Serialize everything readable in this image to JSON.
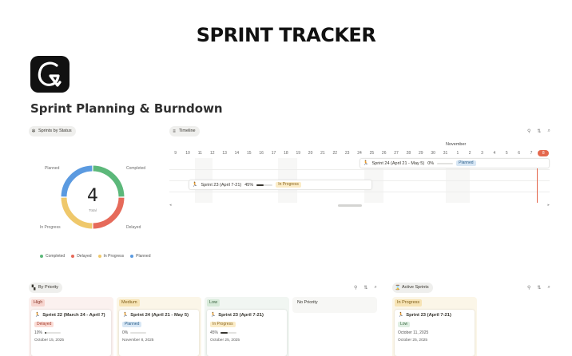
{
  "brand": "SPRINT TRACKER",
  "page_title": "Sprint Planning & Burndown",
  "status_chart": {
    "chip": "Sprints by Status",
    "total": "4",
    "total_label": "Total",
    "labels": {
      "planned": "Planned",
      "completed": "Completed",
      "in_progress": "In Progress",
      "delayed": "Delayed"
    },
    "legend": [
      "Completed",
      "Delayed",
      "In Progress",
      "Planned"
    ]
  },
  "colors": {
    "completed": "#5cb87a",
    "delayed": "#e66a5a",
    "in_progress": "#efc86b",
    "planned": "#5b9ae0",
    "today": "#e4684d"
  },
  "timeline": {
    "chip": "Timeline",
    "month": "November",
    "days": [
      "9",
      "10",
      "11",
      "12",
      "13",
      "14",
      "15",
      "16",
      "17",
      "18",
      "19",
      "20",
      "21",
      "22",
      "23",
      "24",
      "25",
      "26",
      "27",
      "28",
      "29",
      "30",
      "31",
      "1",
      "2",
      "3",
      "4",
      "5",
      "6",
      "7",
      "8"
    ],
    "today": "8",
    "bars": [
      {
        "title": "Sprint 24 (April 21 - May 5)",
        "progress": "0%",
        "progress_value": 0,
        "status": "Planned",
        "status_class": "planned"
      },
      {
        "title": "Sprint 23 (April 7-21)",
        "progress": "45%",
        "progress_value": 0.45,
        "status": "In Progress",
        "status_class": "progress"
      }
    ]
  },
  "board": {
    "chip": "By Priority",
    "columns": [
      {
        "name": "High",
        "card": {
          "title": "Sprint 22 (March 24 - April 7)",
          "status": "Delayed",
          "progress": "10%",
          "progress_value": 0.1,
          "date": "October 15, 2025"
        }
      },
      {
        "name": "Medium",
        "card": {
          "title": "Sprint 24 (April 21 - May 5)",
          "status": "Planned",
          "progress": "0%",
          "progress_value": 0,
          "date": "November 8, 2025"
        }
      },
      {
        "name": "Low",
        "card": {
          "title": "Sprint 23 (April 7-21)",
          "status": "In Progress",
          "progress": "45%",
          "progress_value": 0.45,
          "date": "October 25, 2025"
        }
      },
      {
        "name": "No Priority"
      }
    ]
  },
  "active": {
    "chip": "Active Sprints",
    "column": "In Progress",
    "card": {
      "title": "Sprint 23 (April 7-21)",
      "priority": "Low",
      "start": "October 11, 2025",
      "end": "October 25, 2025"
    }
  }
}
